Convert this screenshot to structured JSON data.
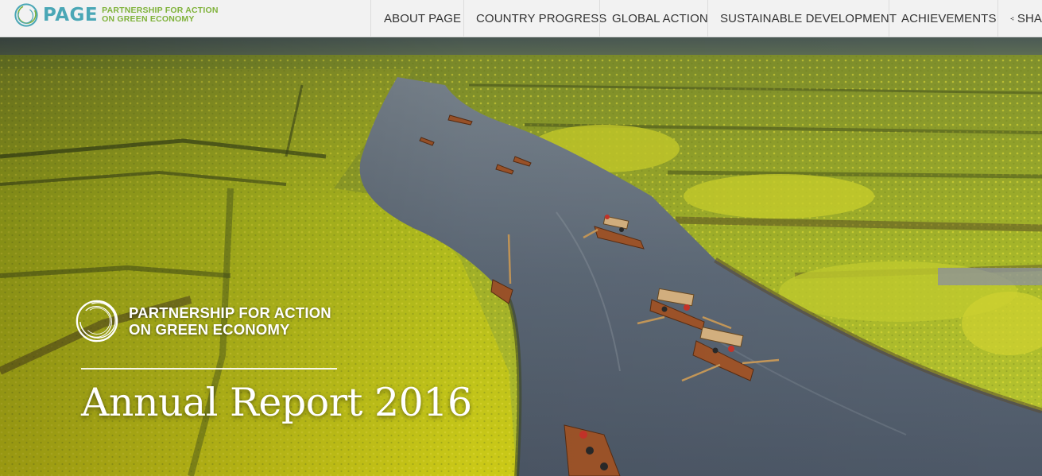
{
  "header": {
    "logo": {
      "wordmark": "PAGE",
      "tagline_line1": "PARTNERSHIP FOR ACTION",
      "tagline_line2": "ON GREEN ECONOMY",
      "icon": "circular-swirl-logo-icon"
    },
    "nav": [
      {
        "label": "ABOUT PAGE"
      },
      {
        "label": "COUNTRY PROGRESS"
      },
      {
        "label": "GLOBAL ACTION"
      },
      {
        "label": "SUSTAINABLE DEVELOPMENT"
      },
      {
        "label": "ACHIEVEMENTS"
      },
      {
        "label": "SHA",
        "icon": "share-icon"
      }
    ]
  },
  "hero": {
    "org_line1": "PARTNERSHIP FOR ACTION",
    "org_line2": "ON GREEN ECONOMY",
    "title": "Annual Report 2016",
    "image": "aerial view of a canal through yellow rapeseed flower fields with small wooden rowing boats"
  },
  "colors": {
    "header_bg": "#f2f2f2",
    "logo_teal": "#4aa7b6",
    "logo_green": "#7fb23a",
    "nav_text": "#333333",
    "hero_text": "#ffffff"
  }
}
